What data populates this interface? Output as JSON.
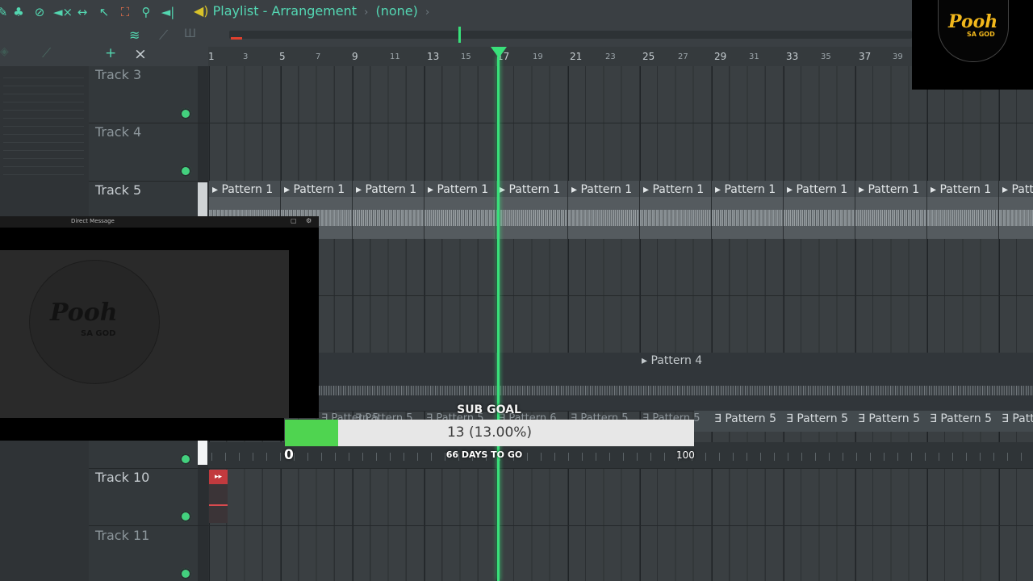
{
  "toolbar": {
    "title_icon": "speaker-icon",
    "title": "Playlist - Arrangement",
    "separator": "›",
    "pattern_selector": "(none)",
    "icons": [
      "brush-icon",
      "paint-icon",
      "mute-icon",
      "speaker-mute-icon",
      "slip-icon",
      "select-icon",
      "marquee-icon",
      "zoom-icon",
      "playback-icon"
    ]
  },
  "toolbar2": {
    "add": "+",
    "remove": "×"
  },
  "ruler": {
    "ticks": [
      "1",
      "3",
      "5",
      "7",
      "9",
      "11",
      "13",
      "15",
      "17",
      "19",
      "21",
      "23",
      "25",
      "27",
      "29",
      "31",
      "33",
      "35",
      "37",
      "39"
    ]
  },
  "tracks": [
    {
      "name": "Track 3"
    },
    {
      "name": "Track 4"
    },
    {
      "name": "Track 5"
    },
    {
      "name": "Track 10"
    },
    {
      "name": "Track 11"
    }
  ],
  "clips": {
    "pattern1": "▸ Pattern 1",
    "pattern4": "▸ Pattern 4",
    "pattern5": "Pattern 5",
    "pattern5_icon": "∃",
    "pattern5_short": "Patt",
    "pattern1_short": "▸ Patt",
    "pattern6": "Pattern 6",
    "red_clip_icon": "▸▸"
  },
  "logo": {
    "text": "Pooh",
    "sub": "SA GOD"
  },
  "direct_messages": {
    "title": "Direct Message",
    "minimize": "▢",
    "close": "⚙",
    "logo_text": "Pooh",
    "logo_sub": "SA GOD"
  },
  "sub_goal": {
    "title": "SUB GOAL",
    "current": 13,
    "target": 100,
    "progress": 0.13,
    "progress_label": "13 (13.00%)",
    "min_label": "0",
    "max_label": "100",
    "days_label": "66 DAYS TO GO",
    "fill_color": "#4fd450"
  },
  "colors": {
    "accent": "#54d8b4",
    "playhead": "#39e07a",
    "track_dot": "#43d17e",
    "logo_gold": "#f2b81c"
  }
}
